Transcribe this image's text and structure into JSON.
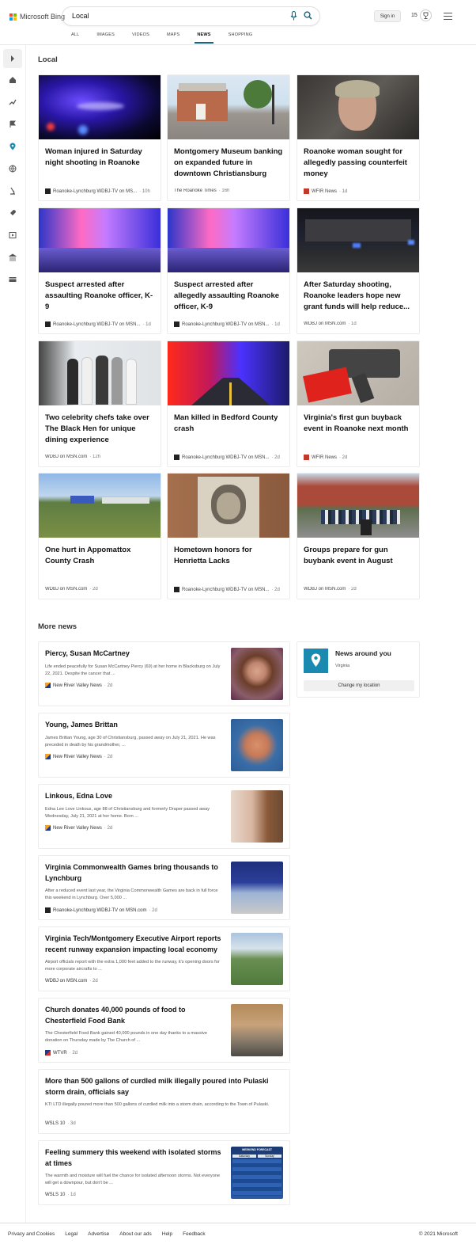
{
  "header": {
    "brand": "Microsoft Bing",
    "search_value": "Local",
    "signin_label": "Sign in",
    "points": "15"
  },
  "tabs": [
    "ALL",
    "IMAGES",
    "VIDEOS",
    "MAPS",
    "NEWS",
    "SHOPPING"
  ],
  "active_tab": "NEWS",
  "local": {
    "heading": "Local",
    "cards": [
      {
        "title": "Woman injured in Saturday night shooting in Roanoke",
        "source": "Roanoke-Lynchburg WDBJ-TV on MS...",
        "ago": "· 10h"
      },
      {
        "title": "Montgomery Museum banking on expanded future in downtown Christiansburg",
        "source": "The Roanoke Times",
        "ago": "· 16h"
      },
      {
        "title": "Roanoke woman sought for allegedly passing counterfeit money",
        "source": "WFIR News",
        "ago": "· 1d"
      },
      {
        "title": "Suspect arrested after assaulting Roanoke officer, K-9",
        "source": "Roanoke-Lynchburg WDBJ-TV on MSN...",
        "ago": "· 1d"
      },
      {
        "title": "Suspect arrested after allegedly assaulting Roanoke officer, K-9",
        "source": "Roanoke-Lynchburg WDBJ-TV on MSN...",
        "ago": "· 1d"
      },
      {
        "title": "After Saturday shooting, Roanoke leaders hope new grant funds will help reduce...",
        "source": "WDBJ on MSN.com",
        "ago": "· 1d"
      },
      {
        "title": "Two celebrity chefs take over The Black Hen for unique dining experience",
        "source": "WDBJ on MSN.com",
        "ago": "· 12h"
      },
      {
        "title": "Man killed in Bedford County crash",
        "source": "Roanoke-Lynchburg WDBJ-TV on MSN...",
        "ago": "· 2d"
      },
      {
        "title": "Virginia's first gun buyback event in Roanoke next month",
        "source": "WFIR News",
        "ago": "· 2d"
      },
      {
        "title": "One hurt in Appomattox County Crash",
        "source": "WDBJ on MSN.com",
        "ago": "· 2d"
      },
      {
        "title": "Hometown honors for Henrietta Lacks",
        "source": "Roanoke-Lynchburg WDBJ-TV on MSN...",
        "ago": "· 2d"
      },
      {
        "title": "Groups prepare for gun buybank event in August",
        "source": "WDBJ on MSN.com",
        "ago": "· 2d"
      }
    ]
  },
  "more_news": {
    "heading": "More news",
    "items": [
      {
        "title": "Piercy, Susan McCartney",
        "desc": "Life ended peacefully for Susan McCartney Piercy (69) at her home in Blacksburg on July 22, 2021. Despite the cancer that ...",
        "source": "New River Valley News",
        "ago": "· 2d"
      },
      {
        "title": "Young, James Brittan",
        "desc": "James Brittan Young, age 30 of Christiansburg, passed away on July 21, 2021. He was preceded in death by his grandmother, ...",
        "source": "New River Valley News",
        "ago": "· 2d"
      },
      {
        "title": "Linkous, Edna Love",
        "desc": "Edna Lee Love Linkous, age 88 of Christiansburg and formerly Draper passed away Wednesday, July 21, 2021 at her home. Born ...",
        "source": "New River Valley News",
        "ago": "· 2d"
      },
      {
        "title": "Virginia Commonwealth Games bring thousands to Lynchburg",
        "desc": "After a reduced event last year, the Virginia Commonwealth Games are back in full force this weekend in Lynchburg. Over 5,000 ...",
        "source": "Roanoke-Lynchburg WDBJ-TV on MSN.com",
        "ago": "· 2d"
      },
      {
        "title": "Virginia Tech/Montgomery Executive Airport reports recent runway expansion impacting local economy",
        "desc": "Airport officials report with the extra 1,000 feet added to the runway, it's opening doors for more corporate aircrafts to ...",
        "source": "WDBJ on MSN.com",
        "ago": "· 2d"
      },
      {
        "title": "Church donates 40,000 pounds of food to Chesterfield Food Bank",
        "desc": "The Chesterfield Food Bank gained 40,000 pounds in one day thanks to a massive donation on Thursday made by The Church of ...",
        "source": "WTVR",
        "ago": "· 2d"
      },
      {
        "title": "More than 500 gallons of curdled milk illegally poured into Pulaski storm drain, officials say",
        "desc": "KTI LTD illegally poured more than 500 gallons of curdled milk into a storm drain, according to the Town of Pulaski.",
        "source": "WSLS 10",
        "ago": "· 3d"
      },
      {
        "title": "Feeling summery this weekend with isolated storms at times",
        "desc": "The warmth and moisture will fuel the chance for isolated afternoon storms. Not everyone will get a downpour, but don't be ...",
        "source": "WSLS 10",
        "ago": "· 1d"
      }
    ]
  },
  "around": {
    "title": "News around you",
    "location": "Virginia",
    "button": "Change my location"
  },
  "weather_thumb": {
    "header": "WEEKEND FORECAST",
    "day1": "Saturday",
    "day2": "Sunday"
  },
  "footer": {
    "links": [
      "Privacy and Cookies",
      "Legal",
      "Advertise",
      "About our ads",
      "Help",
      "Feedback"
    ],
    "copyright": "© 2021 Microsoft"
  },
  "colors": {
    "accent": "#0e6a86",
    "pin": "#1b8ab0"
  }
}
